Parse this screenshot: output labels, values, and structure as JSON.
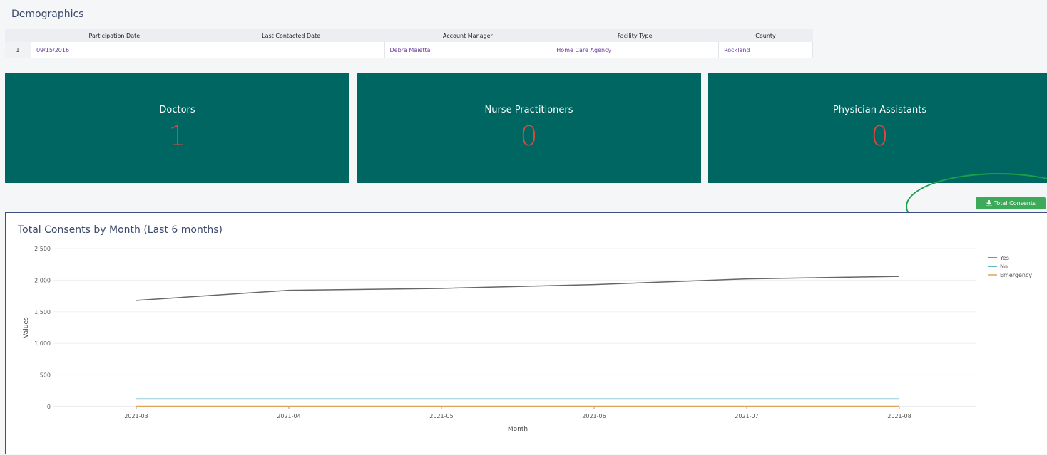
{
  "demographics": {
    "title": "Demographics",
    "columns": [
      "Participation Date",
      "Last Contacted Date",
      "Account Manager",
      "Facility Type",
      "County"
    ],
    "rows": [
      {
        "index": "1",
        "cells": [
          "09/15/2016",
          "",
          "Debra Maietta",
          "Home Care Agency",
          "Rockland"
        ]
      }
    ]
  },
  "kpis": [
    {
      "label": "Doctors",
      "value": "1"
    },
    {
      "label": "Nurse Practitioners",
      "value": "0"
    },
    {
      "label": "Physician Assistants",
      "value": "0"
    }
  ],
  "export_button": {
    "label": "Total Consents",
    "icon": "download-icon"
  },
  "colors": {
    "kpi_bg": "#006661",
    "kpi_value": "#e2463e",
    "button": "#3daa5a",
    "highlight": "#18a14a"
  },
  "chart_data": {
    "type": "line",
    "title": "Total Consents by Month (Last 6 months)",
    "xlabel": "Month",
    "ylabel": "Values",
    "categories": [
      "2021-03",
      "2021-04",
      "2021-05",
      "2021-06",
      "2021-07",
      "2021-08"
    ],
    "ylim": [
      0,
      2500
    ],
    "yticks": [
      0,
      500,
      1000,
      1500,
      2000,
      2500
    ],
    "grid": true,
    "legend_position": "top-right",
    "series": [
      {
        "name": "Yes",
        "color": "#666666",
        "values": [
          1680,
          1840,
          1870,
          1930,
          2020,
          2060
        ]
      },
      {
        "name": "No",
        "color": "#2a9bb5",
        "values": [
          120,
          120,
          120,
          120,
          120,
          120
        ]
      },
      {
        "name": "Emergency",
        "color": "#e0a458",
        "values": [
          5,
          5,
          5,
          5,
          5,
          5
        ]
      }
    ]
  }
}
